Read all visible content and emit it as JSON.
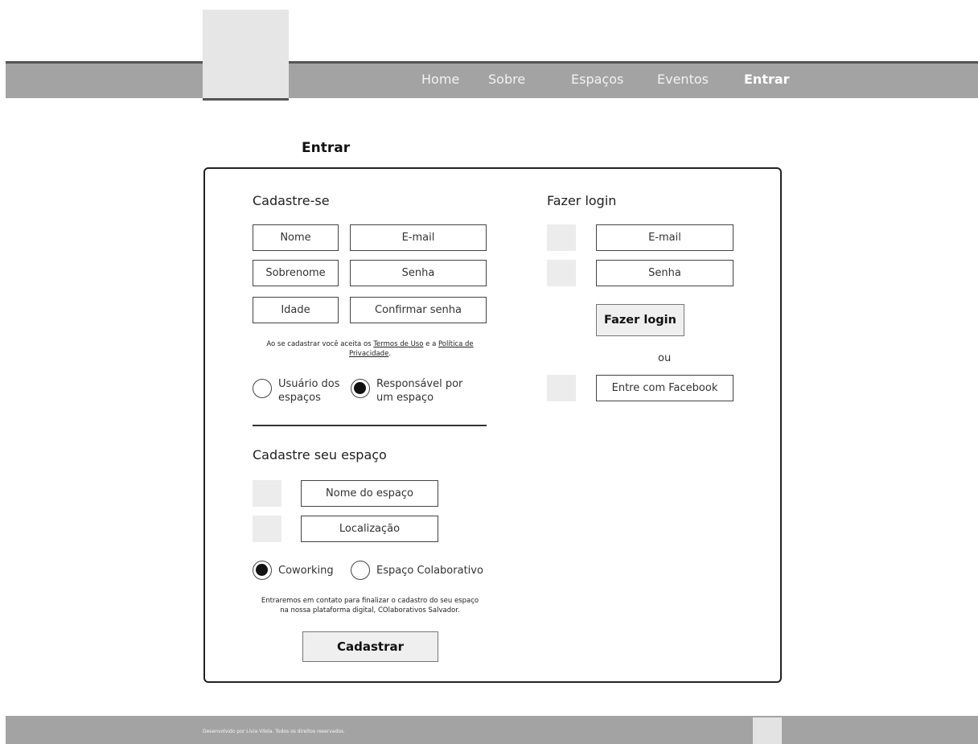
{
  "nav": {
    "home": "Home",
    "about": "Sobre",
    "spaces": "Espaços",
    "events": "Eventos",
    "login": "Entrar"
  },
  "page_title": "Entrar",
  "signup": {
    "title": "Cadastre-se",
    "name_placeholder": "Nome",
    "email_placeholder": "E-mail",
    "surname_placeholder": "Sobrenome",
    "password_placeholder": "Senha",
    "age_placeholder": "Idade",
    "confirm_password_placeholder": "Confirmar senha",
    "terms_prefix": "Ao se cadastrar você aceita os ",
    "terms_link": "Termos de Uso",
    "terms_middle": " e a ",
    "privacy_link_line1": "Política de",
    "privacy_link_line2": "Privacidade",
    "terms_suffix": ".",
    "radio_user_line1": "Usuário dos",
    "radio_user_line2": "espaços",
    "radio_owner_line1": "Responsável por",
    "radio_owner_line2": "um espaço",
    "selected_role": "owner"
  },
  "space": {
    "title": "Cadastre seu espaço",
    "name_placeholder": "Nome do espaço",
    "location_placeholder": "Localização",
    "type_coworking": "Coworking",
    "type_collaborative": "Espaço Colaborativo",
    "selected_type": "coworking",
    "note_line1": "Entraremos em contato para finalizar o cadastro do seu espaço",
    "note_line2": "na nossa plataforma digital, COlaborativos Salvador.",
    "submit_label": "Cadastrar"
  },
  "login": {
    "title": "Fazer login",
    "email_placeholder": "E-mail",
    "password_placeholder": "Senha",
    "submit_label": "Fazer login",
    "or_label": "ou",
    "facebook_label": "Entre com Facebook"
  },
  "footer": {
    "text": "Desenvolvido por Lívia Vilela. Todos os direitos reservados."
  }
}
